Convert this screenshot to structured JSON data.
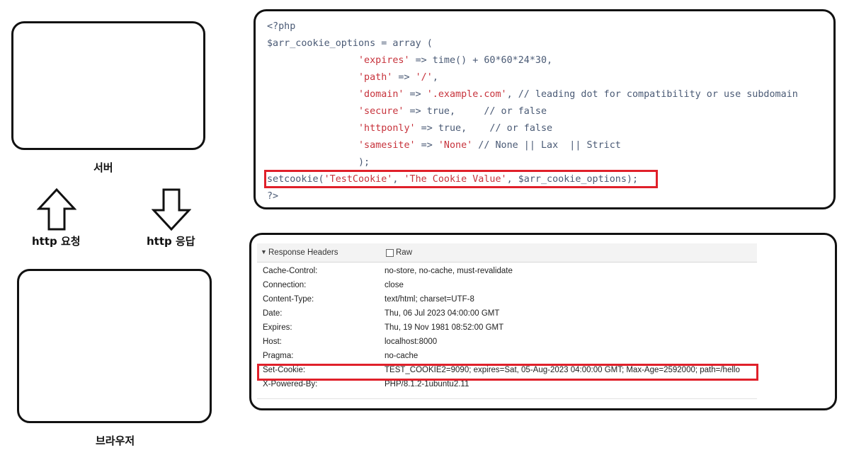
{
  "diagram": {
    "server_label": "서버",
    "browser_label": "브라우저",
    "request_label": "http 요청",
    "response_label": "http 응답"
  },
  "code": {
    "lines": [
      "<?php",
      "$arr_cookie_options = array (",
      "                'expires' => time() + 60*60*24*30,",
      "                'path' => '/',",
      "                'domain' => '.example.com', // leading dot for compatibility or use subdomain",
      "                'secure' => true,     // or false",
      "                'httponly' => true,    // or false",
      "                'samesite' => 'None' // None || Lax  || Strict",
      "                );",
      "setcookie('TestCookie', 'The Cookie Value', $arr_cookie_options);",
      "?>"
    ]
  },
  "headers": {
    "title": "Response Headers",
    "raw_label": "Raw",
    "rows": [
      {
        "key": "Cache-Control:",
        "value": "no-store, no-cache, must-revalidate"
      },
      {
        "key": "Connection:",
        "value": "close"
      },
      {
        "key": "Content-Type:",
        "value": "text/html; charset=UTF-8"
      },
      {
        "key": "Date:",
        "value": "Thu, 06 Jul 2023 04:00:00 GMT"
      },
      {
        "key": "Expires:",
        "value": "Thu, 19 Nov 1981 08:52:00 GMT"
      },
      {
        "key": "Host:",
        "value": "localhost:8000"
      },
      {
        "key": "Pragma:",
        "value": "no-cache"
      },
      {
        "key": "Set-Cookie:",
        "value": "TEST_COOKIE2=9090; expires=Sat, 05-Aug-2023 04:00:00 GMT; Max-Age=2592000; path=/hello"
      },
      {
        "key": "X-Powered-By:",
        "value": "PHP/8.1.2-1ubuntu2.11"
      }
    ]
  },
  "colors": {
    "highlight": "#e0202a",
    "outline": "#111111"
  }
}
